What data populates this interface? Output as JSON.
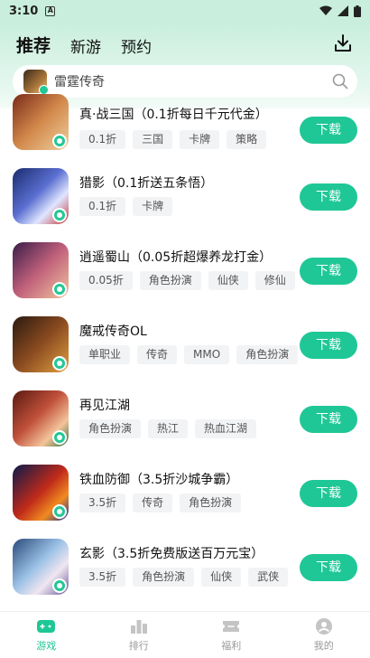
{
  "status_bar": {
    "time": "3:10",
    "notification_letter": "A"
  },
  "header": {
    "tabs": [
      {
        "label": "推荐",
        "active": true
      },
      {
        "label": "新游",
        "active": false
      },
      {
        "label": "预约",
        "active": false
      }
    ],
    "download_icon": "download-tray-icon"
  },
  "search": {
    "placeholder": "雷霆传奇",
    "icon": "search-icon"
  },
  "games": [
    {
      "title": "真·战三国（0.1折每日千元代金）",
      "tags": [
        "0.1折",
        "三国",
        "卡牌",
        "策略"
      ],
      "button": "下载"
    },
    {
      "title": "猎影（0.1折送五条悟）",
      "tags": [
        "0.1折",
        "卡牌"
      ],
      "button": "下载"
    },
    {
      "title": "逍遥蜀山（0.05折超爆养龙打金）",
      "tags": [
        "0.05折",
        "角色扮演",
        "仙侠",
        "修仙"
      ],
      "button": "下载"
    },
    {
      "title": "魔戒传奇OL",
      "tags": [
        "单职业",
        "传奇",
        "MMO",
        "角色扮演"
      ],
      "button": "下载"
    },
    {
      "title": "再见江湖",
      "tags": [
        "角色扮演",
        "热江",
        "热血江湖"
      ],
      "button": "下载"
    },
    {
      "title": "铁血防御（3.5折沙城争霸）",
      "tags": [
        "3.5折",
        "传奇",
        "角色扮演"
      ],
      "button": "下载"
    },
    {
      "title": "玄影（3.5折免费版送百万元宝）",
      "tags": [
        "3.5折",
        "角色扮演",
        "仙侠",
        "武侠"
      ],
      "button": "下载"
    }
  ],
  "bottom_nav": [
    {
      "label": "游戏",
      "icon": "gamepad-icon",
      "active": true
    },
    {
      "label": "排行",
      "icon": "ranking-bars-icon",
      "active": false
    },
    {
      "label": "福利",
      "icon": "ticket-icon",
      "active": false
    },
    {
      "label": "我的",
      "icon": "profile-icon",
      "active": false
    }
  ],
  "colors": {
    "accent": "#1fc796",
    "header_bg": "#c9eedd",
    "tab_underline": "#62dcb2"
  }
}
